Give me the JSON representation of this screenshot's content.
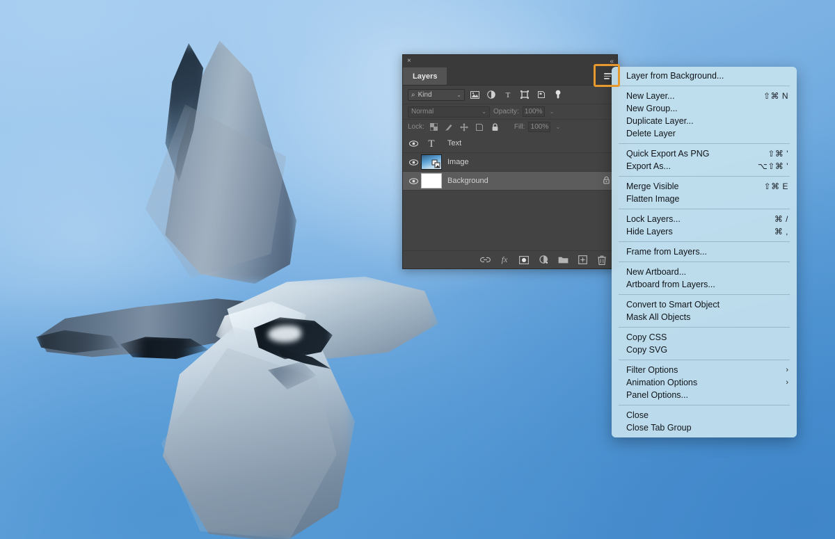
{
  "background": {
    "description": "blurred photo of a tern in flight against blue sky",
    "sky_top_color": "#9EC8EE",
    "sky_bottom_color": "#4A90CF"
  },
  "panel": {
    "close_glyph": "×",
    "collapse_glyph": "«",
    "tab_label": "Layers",
    "menu_icon": "hamburger-icon",
    "highlight_color": "#E69A2E",
    "filter": {
      "search_glyph": "⌕",
      "kind_label": "Kind",
      "chevron": "⌄",
      "icons": [
        "pixel-layer-icon",
        "adjustment-layer-icon",
        "type-layer-icon",
        "shape-layer-icon",
        "smart-object-icon",
        "toggle-filter-icon"
      ]
    },
    "blend": {
      "mode": "Normal",
      "chevron": "⌄",
      "opacity_label": "Opacity:",
      "opacity_value": "100%"
    },
    "lock": {
      "label": "Lock:",
      "icons": [
        "transparent-pixels-icon",
        "image-pixels-icon",
        "position-icon",
        "artboard-nesting-icon",
        "lock-all-icon"
      ],
      "fill_label": "Fill:",
      "fill_value": "100%"
    },
    "layers": [
      {
        "name": "Text",
        "thumb": "type-T",
        "visible": true,
        "selected": false,
        "locked": false
      },
      {
        "name": "Image",
        "thumb": "image",
        "visible": true,
        "selected": false,
        "locked": false
      },
      {
        "name": "Background",
        "thumb": "white",
        "visible": true,
        "selected": true,
        "locked": true
      }
    ],
    "bottom_icons": [
      "link-layers-icon",
      "layer-style-fx-icon",
      "add-mask-icon",
      "adjustment-layer-icon",
      "new-group-icon",
      "new-layer-icon",
      "delete-layer-icon"
    ],
    "fx_label": "fx"
  },
  "context_menu": {
    "groups": [
      {
        "items": [
          {
            "label": "Layer from Background...",
            "shortcut": "",
            "arrow": ""
          }
        ]
      },
      {
        "items": [
          {
            "label": "New Layer...",
            "shortcut": "⇧⌘ N",
            "arrow": ""
          },
          {
            "label": "New Group...",
            "shortcut": "",
            "arrow": ""
          },
          {
            "label": "Duplicate Layer...",
            "shortcut": "",
            "arrow": ""
          },
          {
            "label": "Delete Layer",
            "shortcut": "",
            "arrow": ""
          }
        ]
      },
      {
        "items": [
          {
            "label": "Quick Export As PNG",
            "shortcut": "⇧⌘ '",
            "arrow": ""
          },
          {
            "label": "Export As...",
            "shortcut": "⌥⇧⌘ '",
            "arrow": ""
          }
        ]
      },
      {
        "items": [
          {
            "label": "Merge Visible",
            "shortcut": "⇧⌘ E",
            "arrow": ""
          },
          {
            "label": "Flatten Image",
            "shortcut": "",
            "arrow": ""
          }
        ]
      },
      {
        "items": [
          {
            "label": "Lock Layers...",
            "shortcut": "⌘ /",
            "arrow": ""
          },
          {
            "label": "Hide Layers",
            "shortcut": "⌘ ,",
            "arrow": ""
          }
        ]
      },
      {
        "items": [
          {
            "label": "Frame from Layers...",
            "shortcut": "",
            "arrow": ""
          }
        ]
      },
      {
        "items": [
          {
            "label": "New Artboard...",
            "shortcut": "",
            "arrow": ""
          },
          {
            "label": "Artboard from Layers...",
            "shortcut": "",
            "arrow": ""
          }
        ]
      },
      {
        "items": [
          {
            "label": "Convert to Smart Object",
            "shortcut": "",
            "arrow": ""
          },
          {
            "label": "Mask All Objects",
            "shortcut": "",
            "arrow": ""
          }
        ]
      },
      {
        "items": [
          {
            "label": "Copy CSS",
            "shortcut": "",
            "arrow": ""
          },
          {
            "label": "Copy SVG",
            "shortcut": "",
            "arrow": ""
          }
        ]
      },
      {
        "items": [
          {
            "label": "Filter Options",
            "shortcut": "",
            "arrow": "›"
          },
          {
            "label": "Animation Options",
            "shortcut": "",
            "arrow": "›"
          },
          {
            "label": "Panel Options...",
            "shortcut": "",
            "arrow": ""
          }
        ]
      },
      {
        "items": [
          {
            "label": "Close",
            "shortcut": "",
            "arrow": ""
          },
          {
            "label": "Close Tab Group",
            "shortcut": "",
            "arrow": ""
          }
        ]
      }
    ]
  }
}
